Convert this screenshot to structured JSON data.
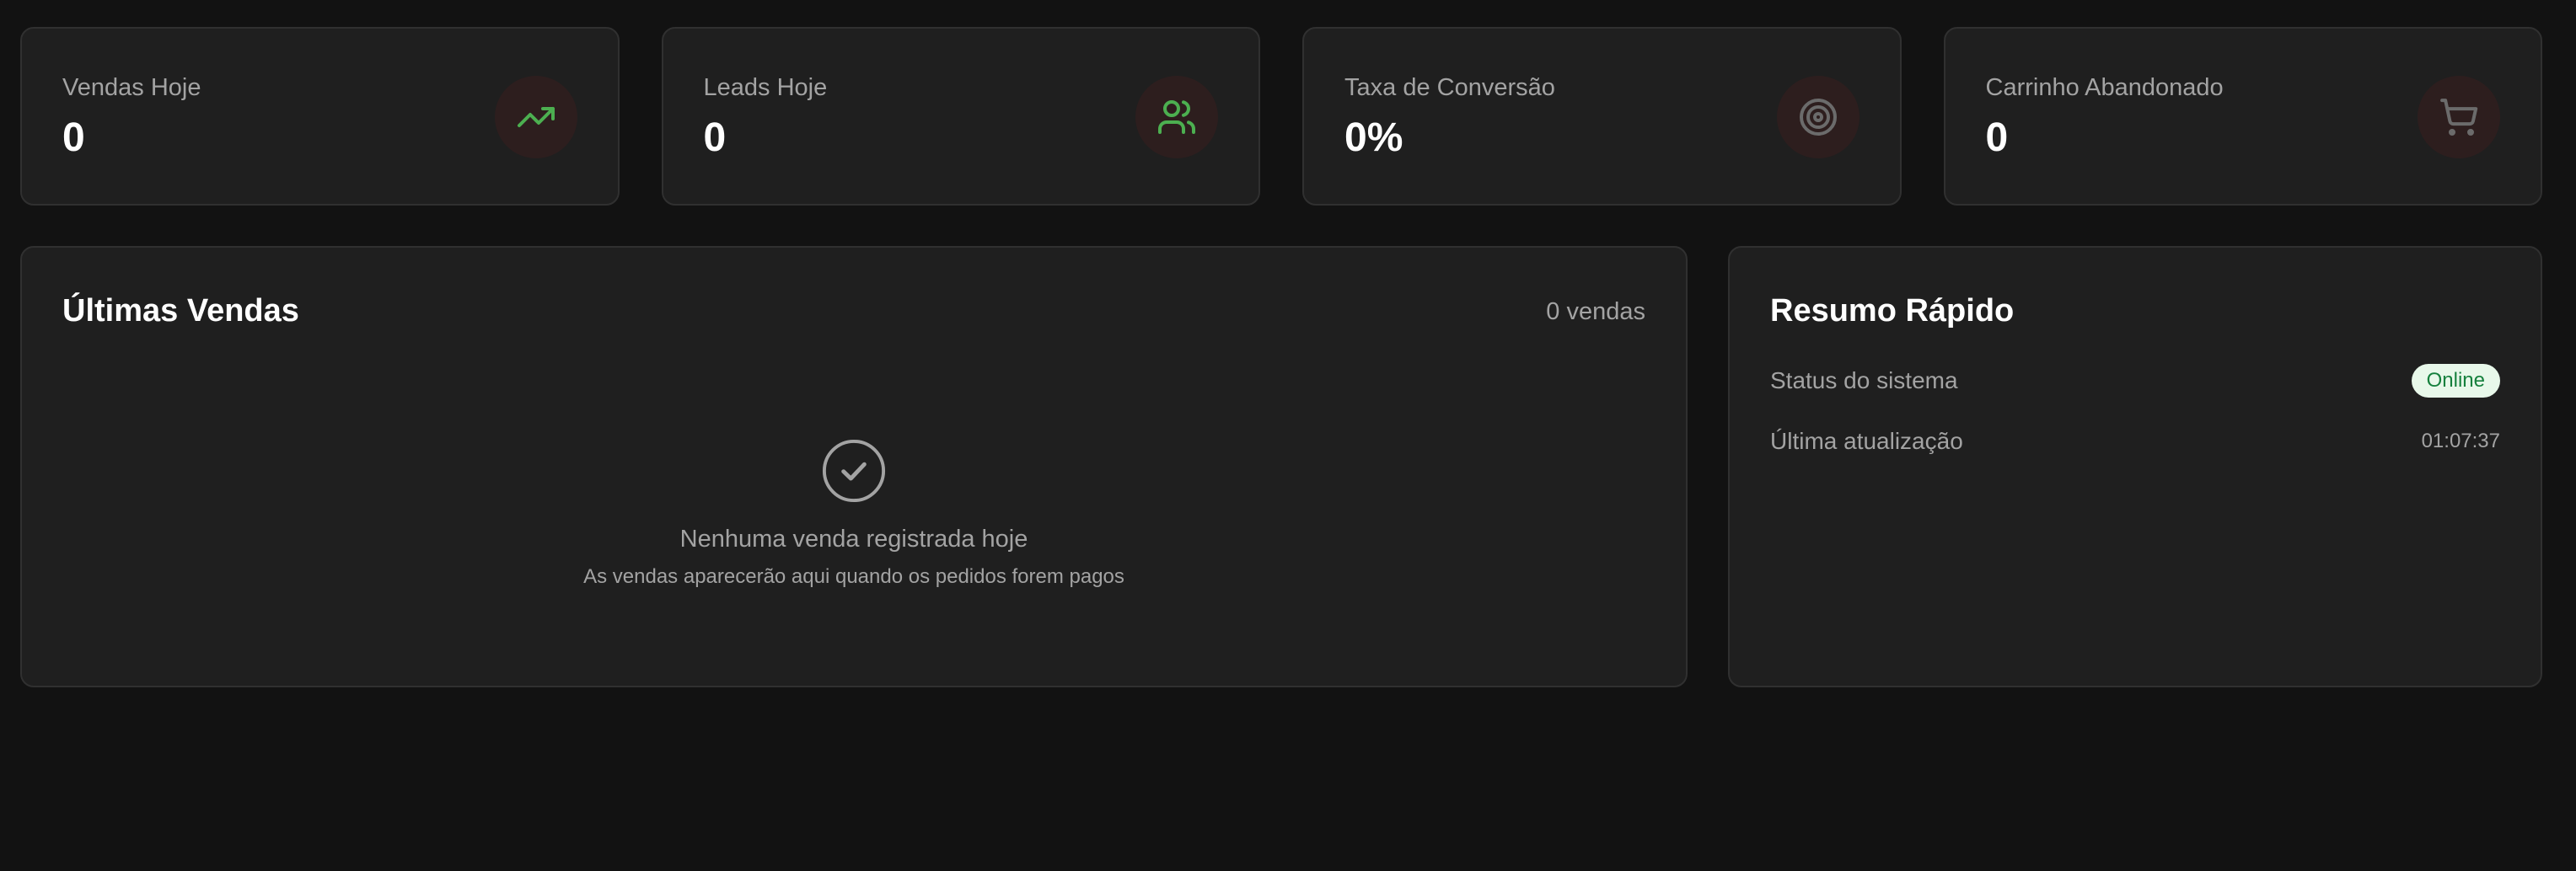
{
  "stats": [
    {
      "label": "Vendas Hoje",
      "value": "0",
      "icon": "trending-up-icon",
      "icon_color": "#4caf50"
    },
    {
      "label": "Leads Hoje",
      "value": "0",
      "icon": "users-icon",
      "icon_color": "#4caf50"
    },
    {
      "label": "Taxa de Conversão",
      "value": "0%",
      "icon": "target-icon",
      "icon_color": "#6b6b6b"
    },
    {
      "label": "Carrinho Abandonado",
      "value": "0",
      "icon": "cart-icon",
      "icon_color": "#6b6b6b"
    }
  ],
  "sales": {
    "title": "Últimas Vendas",
    "count": "0 vendas",
    "empty_icon": "check-circle-icon",
    "empty_title": "Nenhuma venda registrada hoje",
    "empty_subtitle": "As vendas aparecerão aqui quando os pedidos forem pagos"
  },
  "summary": {
    "title": "Resumo Rápido",
    "rows": [
      {
        "label": "Status do sistema",
        "value": "Online"
      },
      {
        "label": "Última atualização",
        "value": "01:07:37"
      }
    ]
  },
  "colors": {
    "background": "#121212",
    "card": "#1f1f1f",
    "border": "#303030",
    "icon_bg": "#2d1e1e",
    "accent_green": "#4caf50",
    "badge_bg": "#e8f8ea",
    "badge_text": "#15803d"
  }
}
